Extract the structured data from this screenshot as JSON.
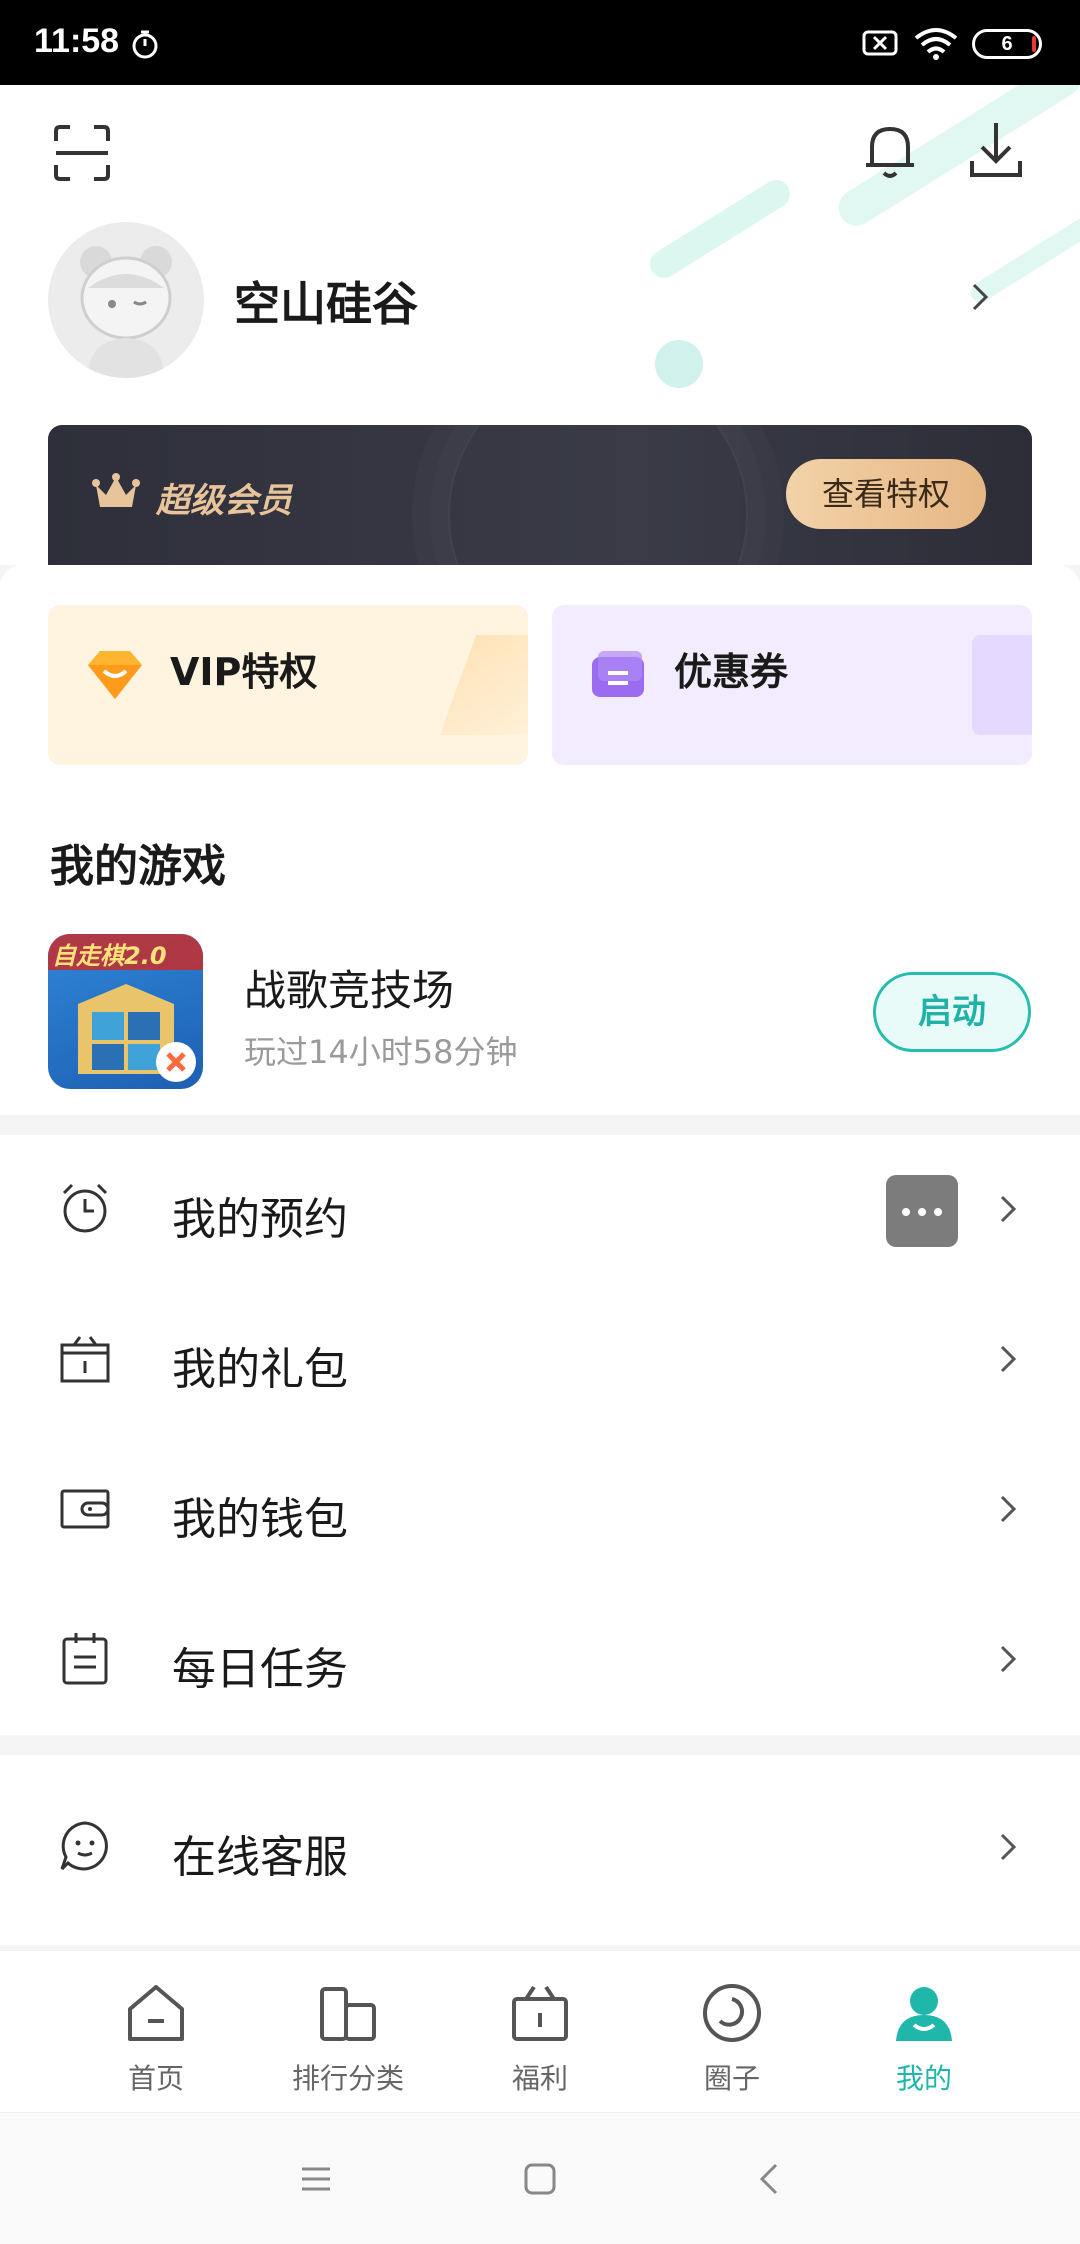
{
  "status_bar": {
    "time": "11:58",
    "battery": "6"
  },
  "header": {
    "username": "空山硅谷"
  },
  "vip_banner": {
    "title": "超级会员",
    "button": "查看特权"
  },
  "cards": [
    {
      "label": "VIP特权",
      "icon": "diamond-icon"
    },
    {
      "label": "优惠券",
      "icon": "coupon-icon"
    }
  ],
  "my_games": {
    "title": "我的游戏",
    "game": {
      "name": "战歌竞技场",
      "playtime": "玩过14小时58分钟",
      "icon_text": "自走棋2.0",
      "action": "启动"
    }
  },
  "menu": [
    {
      "label": "我的预约",
      "icon": "alarm-clock-icon"
    },
    {
      "label": "我的礼包",
      "icon": "gift-box-icon"
    },
    {
      "label": "我的钱包",
      "icon": "wallet-icon"
    },
    {
      "label": "每日任务",
      "icon": "clipboard-icon"
    },
    {
      "label": "在线客服",
      "icon": "customer-service-icon"
    }
  ],
  "tabs": [
    {
      "label": "首页",
      "icon": "home-icon"
    },
    {
      "label": "排行分类",
      "icon": "ranking-icon"
    },
    {
      "label": "福利",
      "icon": "gift-icon"
    },
    {
      "label": "圈子",
      "icon": "circle-icon"
    },
    {
      "label": "我的",
      "icon": "profile-icon",
      "active": true
    }
  ],
  "colors": {
    "accent": "#1fb7aa",
    "vip_gold": "#e8c49a",
    "vip_bg": "#2e2f3a"
  }
}
